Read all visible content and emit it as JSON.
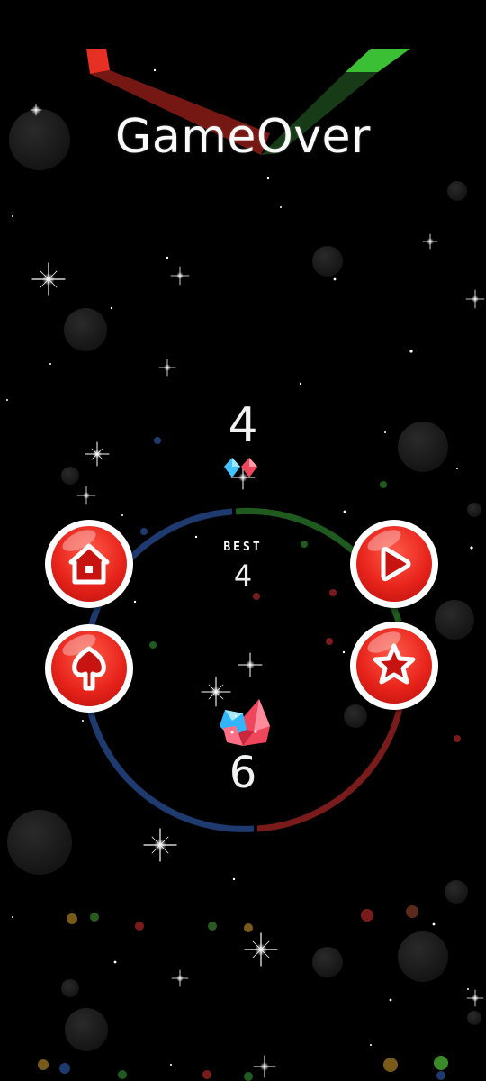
{
  "game": {
    "title": "GameOver",
    "score": "4",
    "best_label": "BEST",
    "best_value": "4",
    "gems": "6"
  },
  "buttons": {
    "home": "home-icon",
    "play": "play-icon",
    "upgrade": "upgrade-arrow-icon",
    "rate": "star-icon"
  },
  "colors": {
    "background": "#000000",
    "button_red": "#e8241b",
    "ring_blue": "#1e3a6e",
    "ring_green": "#1f5a1f",
    "ring_red": "#7a1b1b",
    "bar_red": "#e53023",
    "bar_green": "#3bbf35"
  }
}
